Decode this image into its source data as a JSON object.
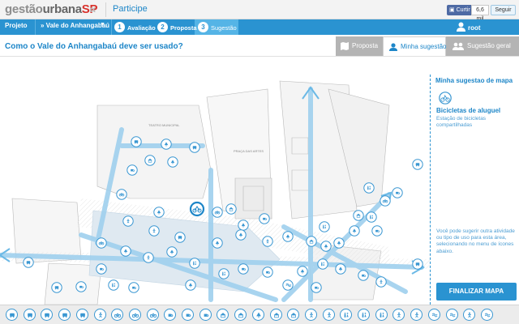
{
  "header": {
    "logo_prefix": "gestão",
    "logo_middle": "urbana",
    "logo_suffix": "SP",
    "collapse_glyph": "«",
    "participe": "Participe",
    "like_label": "Curtir",
    "like_count": "6,6 mil",
    "follow_label": "Seguir",
    "accent_color": "#2a93d1"
  },
  "nav": {
    "projeto": "Projeto",
    "project_name": "» Vale do Anhangabaú",
    "steps": [
      {
        "num": "1",
        "label": "Avaliação"
      },
      {
        "num": "2",
        "label": "Proposta"
      },
      {
        "num": "3",
        "label": "Sugestão"
      }
    ],
    "user": "root"
  },
  "question": "Como o Vale do Anhangabaú deve ser usado?",
  "view_tabs": {
    "proposta": "Proposta",
    "minha": "Minha sugestão",
    "geral": "Sugestão geral"
  },
  "map": {
    "labels": [
      "TEATRO MUNICIPAL",
      "PRAÇA DAS ARTES"
    ]
  },
  "panel": {
    "title": "Minha sugestao de mapa",
    "item_icon": "bicycle-icon",
    "item_title": "Bicicletas de aluguel",
    "item_desc": "Estação de bicicletas compartilhadas",
    "hint": "Você pode sugerir outra atividade ou tipo de uso para esta área, selecionando no menu de ícones abaixo.",
    "finalizar": "FINALIZAR MAPA"
  },
  "toolbar_icons": [
    "bus-icon",
    "car-icon",
    "car-icon",
    "taxi-icon",
    "bus-icon",
    "accessibility-icon",
    "bicycle-icon",
    "bicycle-icon",
    "bicycle-icon",
    "coffee-icon",
    "bench-icon",
    "picnic-icon",
    "market-icon",
    "tent-icon",
    "tree-icon",
    "kiosk-icon",
    "kiosk-icon",
    "walk-icon",
    "run-icon",
    "family-icon",
    "people-icon",
    "toilet-icon",
    "playground-icon",
    "dog-icon",
    "music-icon",
    "wifi-icon",
    "skate-icon",
    "water-icon"
  ]
}
